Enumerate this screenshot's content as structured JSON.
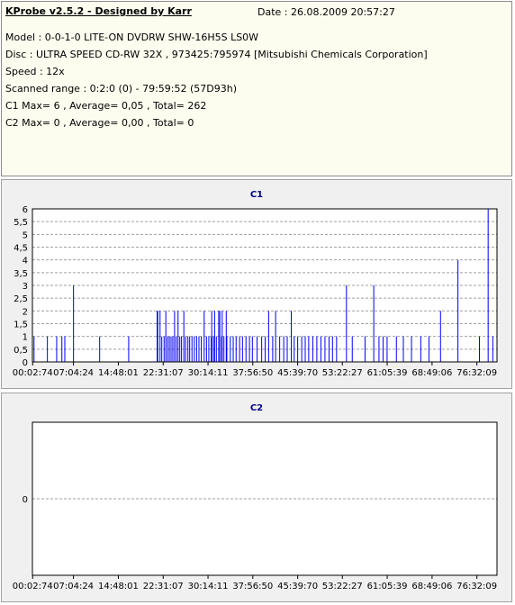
{
  "info": {
    "title": "KProbe v2.5.2 - Designed by Karr",
    "date": "Date : 26.08.2009 20:57:27",
    "lines": [
      "Model : 0-0-1-0 LITE-ON DVDRW SHW-16H5S  LS0W",
      "Disc : ULTRA SPEED CD-RW 32X , 973425:795974 [Mitsubishi Chemicals Corporation]",
      "Speed : 12x",
      "Scanned range : 0:2:0 (0) - 79:59:52 (57D93h)",
      "C1 Max= 6 , Average= 0,05 , Total= 262",
      "C2 Max= 0 , Average= 0,00 , Total= 0"
    ]
  },
  "colors": {
    "bar": "#0000ff",
    "grid": "#a0a0a0",
    "plot_bg": "#ffffff",
    "panel_bg": "#f0f0f0",
    "title": "#00008a"
  },
  "chart_data": [
    {
      "type": "bar",
      "title": "C1",
      "x_tick_labels": [
        "00:02:74",
        "07:04:24",
        "14:48:01",
        "22:31:07",
        "30:14:11",
        "37:56:50",
        "45:39:70",
        "53:22:27",
        "61:05:39",
        "68:49:06",
        "76:32:09"
      ],
      "x_ticks_minutes": [
        0.04,
        7.07,
        14.8,
        22.52,
        30.24,
        37.95,
        45.68,
        53.37,
        61.09,
        68.82,
        76.54
      ],
      "xlim": [
        0,
        80
      ],
      "ylim": [
        0,
        6
      ],
      "y_ticks": [
        0,
        0.5,
        1,
        1.5,
        2,
        2.5,
        3,
        3.5,
        4,
        4.5,
        5,
        5.5,
        6
      ],
      "grid": "horizontal dashed",
      "bars": [
        [
          0.2,
          1
        ],
        [
          2.5,
          1
        ],
        [
          4.1,
          1
        ],
        [
          5.0,
          1
        ],
        [
          5.5,
          1
        ],
        [
          7.0,
          3
        ],
        [
          11.5,
          1
        ],
        [
          16.5,
          1
        ],
        [
          21.4,
          2
        ],
        [
          21.5,
          2
        ],
        [
          21.9,
          2
        ],
        [
          22.2,
          1
        ],
        [
          22.6,
          1
        ],
        [
          22.9,
          2
        ],
        [
          23.2,
          1
        ],
        [
          23.5,
          1
        ],
        [
          23.8,
          1
        ],
        [
          24.1,
          1
        ],
        [
          24.4,
          2
        ],
        [
          24.7,
          1
        ],
        [
          25.0,
          2
        ],
        [
          25.3,
          1
        ],
        [
          25.6,
          1
        ],
        [
          26.0,
          2
        ],
        [
          26.3,
          1
        ],
        [
          26.7,
          1
        ],
        [
          27.0,
          1
        ],
        [
          27.4,
          1
        ],
        [
          27.8,
          1
        ],
        [
          28.2,
          1
        ],
        [
          28.6,
          1
        ],
        [
          29.0,
          1
        ],
        [
          29.5,
          2
        ],
        [
          29.9,
          1
        ],
        [
          30.3,
          1
        ],
        [
          30.7,
          1
        ],
        [
          31.1,
          1
        ],
        [
          31.6,
          1
        ],
        [
          32.0,
          2
        ],
        [
          32.5,
          1
        ],
        [
          32.9,
          1
        ],
        [
          33.4,
          1
        ],
        [
          34.0,
          1
        ],
        [
          34.5,
          1
        ],
        [
          35.0,
          1
        ],
        [
          35.6,
          1
        ],
        [
          36.1,
          1
        ],
        [
          36.7,
          1
        ],
        [
          37.3,
          1
        ],
        [
          37.8,
          1
        ],
        [
          30.8,
          2
        ],
        [
          32.2,
          2
        ],
        [
          31.3,
          2
        ],
        [
          32.6,
          2
        ],
        [
          33.3,
          2
        ],
        [
          38.6,
          1
        ],
        [
          39.4,
          1
        ],
        [
          40.0,
          1
        ],
        [
          40.6,
          2
        ],
        [
          41.3,
          1
        ],
        [
          41.8,
          2
        ],
        [
          42.5,
          1
        ],
        [
          43.2,
          1
        ],
        [
          43.8,
          1
        ],
        [
          44.5,
          2
        ],
        [
          45.0,
          1
        ],
        [
          45.6,
          1
        ],
        [
          46.3,
          1
        ],
        [
          46.9,
          1
        ],
        [
          47.5,
          1
        ],
        [
          48.2,
          1
        ],
        [
          48.9,
          1
        ],
        [
          49.6,
          1
        ],
        [
          50.3,
          1
        ],
        [
          51.0,
          1
        ],
        [
          51.6,
          1
        ],
        [
          52.3,
          1
        ],
        [
          54.0,
          3
        ],
        [
          55.0,
          1
        ],
        [
          57.2,
          1
        ],
        [
          58.7,
          3
        ],
        [
          59.6,
          1
        ],
        [
          60.3,
          1
        ],
        [
          61.0,
          1
        ],
        [
          62.6,
          1
        ],
        [
          63.8,
          1
        ],
        [
          65.2,
          1
        ],
        [
          66.8,
          1
        ],
        [
          68.2,
          1
        ],
        [
          70.2,
          2
        ],
        [
          73.2,
          4
        ],
        [
          76.9,
          1
        ],
        [
          78.4,
          6
        ],
        [
          79.2,
          1
        ]
      ]
    },
    {
      "type": "bar",
      "title": "C2",
      "x_tick_labels": [
        "00:02:74",
        "07:04:24",
        "14:48:01",
        "22:31:07",
        "30:14:11",
        "37:56:50",
        "45:39:70",
        "53:22:27",
        "61:05:39",
        "68:49:06",
        "76:32:09"
      ],
      "x_ticks_minutes": [
        0.04,
        7.07,
        14.8,
        22.52,
        30.24,
        37.95,
        45.68,
        53.37,
        61.09,
        68.82,
        76.54
      ],
      "xlim": [
        0,
        80
      ],
      "ylim": [
        -1,
        1
      ],
      "y_ticks": [
        0
      ],
      "grid": "horizontal dashed",
      "bars": []
    }
  ]
}
